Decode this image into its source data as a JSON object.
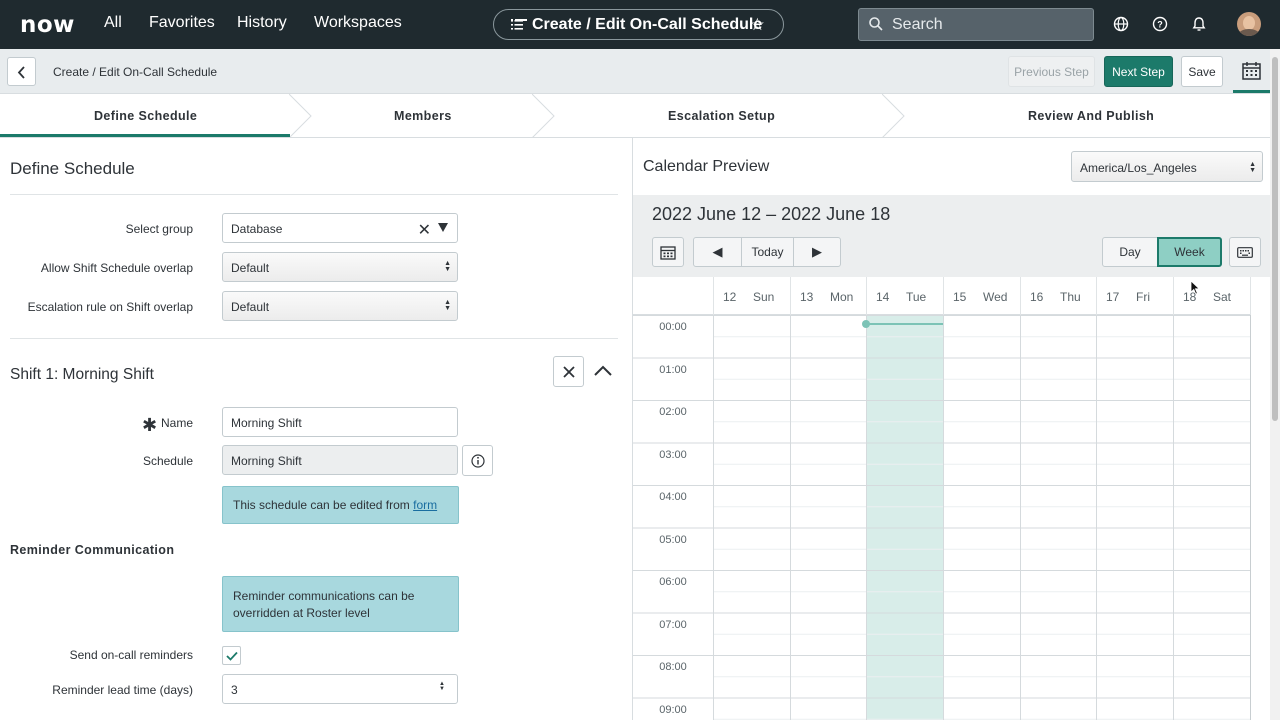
{
  "nav": {
    "logo": "now",
    "links": [
      "All",
      "Favorites",
      "History",
      "Workspaces"
    ],
    "context_title": "Create / Edit On-Call Schedule",
    "search_placeholder": "Search"
  },
  "subheader": {
    "breadcrumb": "Create / Edit On-Call Schedule",
    "prev_label": "Previous Step",
    "next_label": "Next Step",
    "save_label": "Save"
  },
  "steps": [
    "Define Schedule",
    "Members",
    "Escalation Setup",
    "Review And Publish"
  ],
  "form": {
    "title": "Define Schedule",
    "select_group_label": "Select group",
    "select_group_value": "Database",
    "overlap_label": "Allow Shift Schedule overlap",
    "overlap_value": "Default",
    "escalation_label": "Escalation rule on Shift overlap",
    "escalation_value": "Default",
    "shift_title": "Shift 1: Morning Shift",
    "name_label": "Name",
    "name_value": "Morning Shift",
    "schedule_label": "Schedule",
    "schedule_value": "Morning Shift",
    "schedule_note": "This schedule can be edited from",
    "schedule_note_link": "form",
    "reminder_title": "Reminder Communication",
    "reminder_note": "Reminder communications can be overridden at Roster level",
    "send_reminders_label": "Send on-call reminders",
    "send_reminders_checked": true,
    "lead_time_label": "Reminder lead time (days)",
    "lead_time_value": "3"
  },
  "calendar": {
    "title": "Calendar Preview",
    "timezone": "America/Los_Angeles",
    "range": "2022 June 12 – 2022 June 18",
    "today_label": "Today",
    "day_label": "Day",
    "week_label": "Week",
    "days": [
      {
        "num": "12",
        "name": "Sun"
      },
      {
        "num": "13",
        "name": "Mon"
      },
      {
        "num": "14",
        "name": "Tue"
      },
      {
        "num": "15",
        "name": "Wed"
      },
      {
        "num": "16",
        "name": "Thu"
      },
      {
        "num": "17",
        "name": "Fri"
      },
      {
        "num": "18",
        "name": "Sat"
      }
    ],
    "hours": [
      "00:00",
      "01:00",
      "02:00",
      "03:00",
      "04:00",
      "05:00",
      "06:00",
      "07:00",
      "08:00",
      "09:00"
    ],
    "highlight_color": "#d8ede9",
    "accent_color": "#1c7a6a"
  }
}
